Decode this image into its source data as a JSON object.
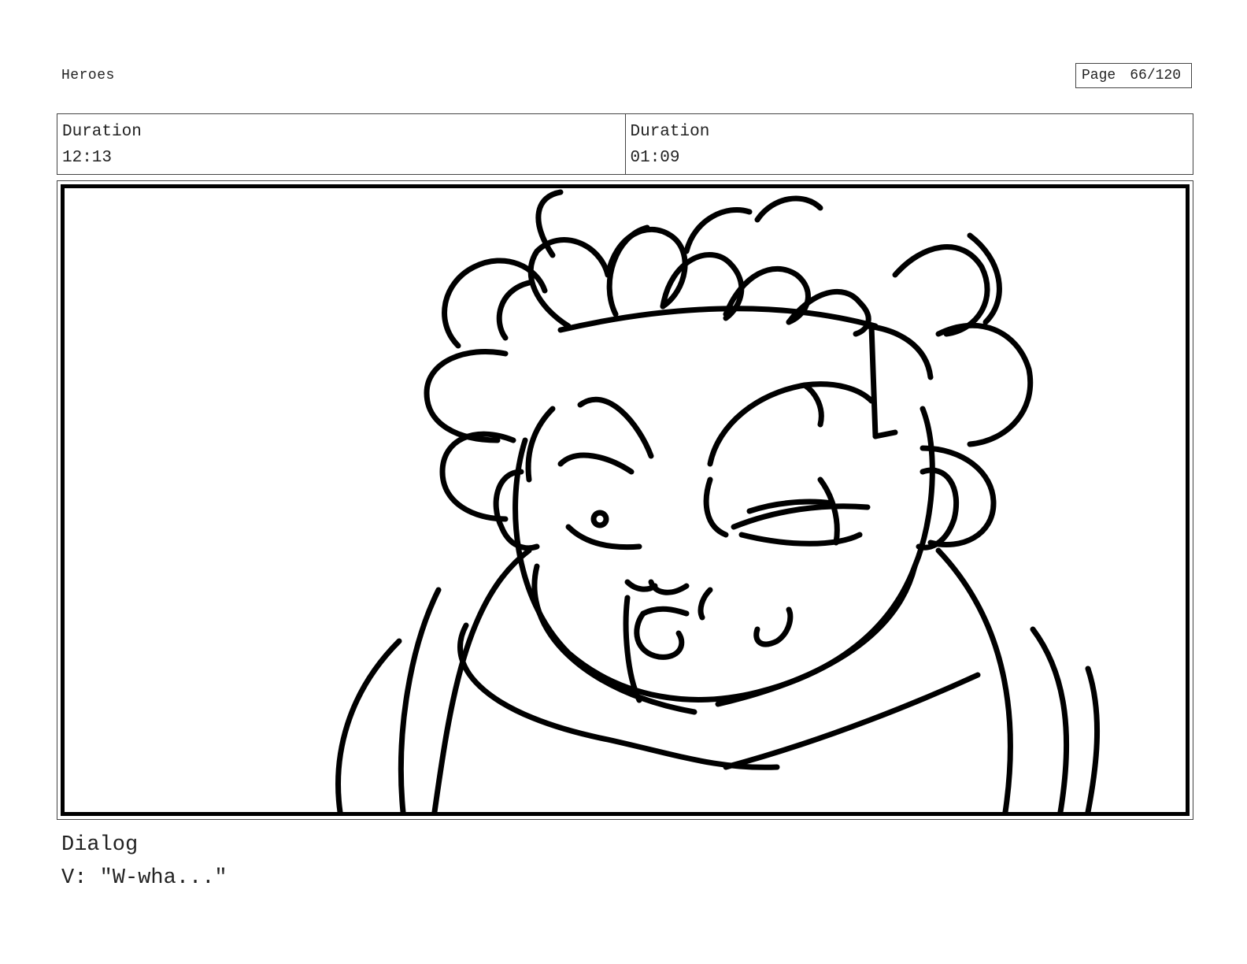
{
  "header": {
    "project_title": "Heroes",
    "page_label": "Page",
    "page_number": "66/120"
  },
  "durations": [
    {
      "label": "Duration",
      "value": "12:13"
    },
    {
      "label": "Duration",
      "value": "01:09"
    }
  ],
  "dialog": {
    "label": "Dialog",
    "line": "V: \"W-wha...\""
  }
}
